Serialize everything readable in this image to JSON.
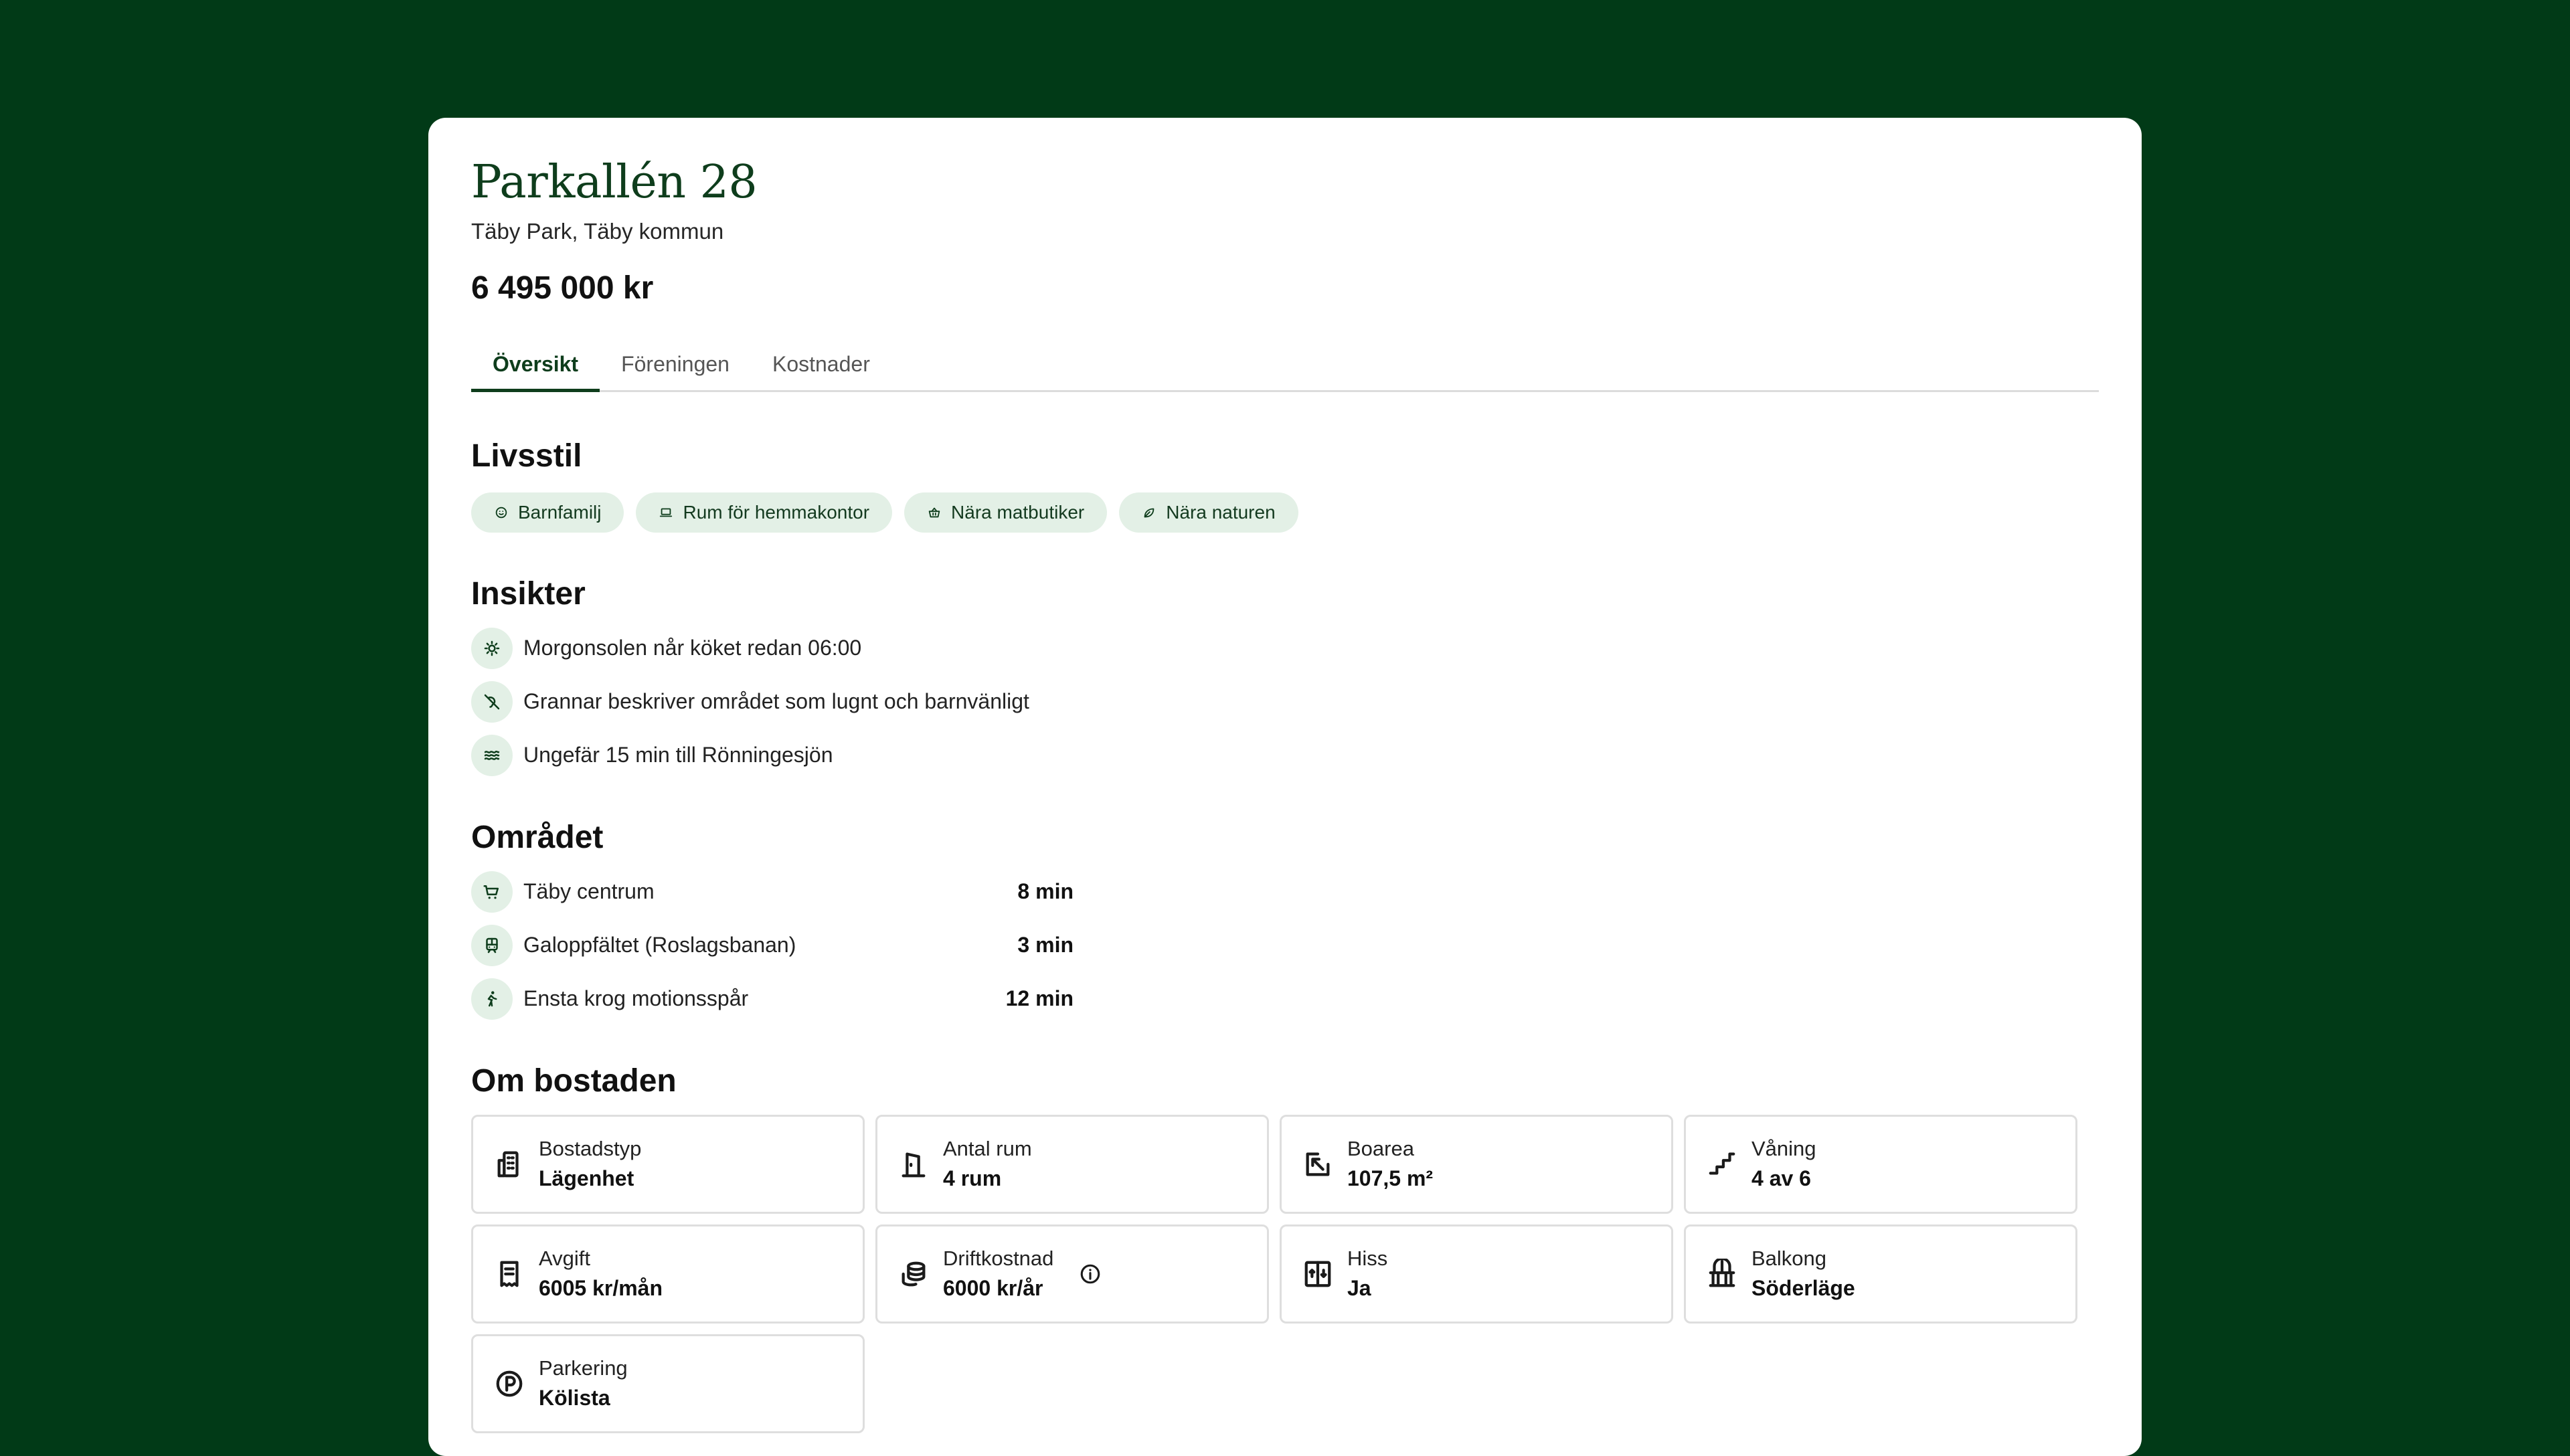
{
  "listing": {
    "title": "Parkallén 28",
    "subtitle": "Täby Park, Täby kommun",
    "price": "6 495 000 kr"
  },
  "tabs": [
    {
      "label": "Översikt",
      "active": true
    },
    {
      "label": "Föreningen",
      "active": false
    },
    {
      "label": "Kostnader",
      "active": false
    }
  ],
  "livsstil": {
    "title": "Livsstil",
    "chips": [
      {
        "label": "Barnfamilj",
        "icon": "smile-icon"
      },
      {
        "label": "Rum för hemmakontor",
        "icon": "laptop-icon"
      },
      {
        "label": "Nära matbutiker",
        "icon": "basket-icon"
      },
      {
        "label": "Nära naturen",
        "icon": "leaf-icon"
      }
    ]
  },
  "insikter": {
    "title": "Insikter",
    "items": [
      {
        "text": "Morgonsolen når köket redan 06:00",
        "icon": "sun-icon"
      },
      {
        "text": "Grannar beskriver området som lugnt och barnvänligt",
        "icon": "volume-off-icon"
      },
      {
        "text": "Ungefär 15 min till Rönningesjön",
        "icon": "waves-icon"
      }
    ]
  },
  "omradet": {
    "title": "Området",
    "items": [
      {
        "place": "Täby centrum",
        "time": "8 min",
        "icon": "cart-icon"
      },
      {
        "place": "Galoppfältet (Roslagsbanan)",
        "time": "3 min",
        "icon": "train-icon"
      },
      {
        "place": "Ensta krog motionsspår",
        "time": "12 min",
        "icon": "walk-icon"
      }
    ]
  },
  "om_bostaden": {
    "title": "Om bostaden",
    "features": [
      {
        "label": "Bostadstyp",
        "value": "Lägenhet",
        "icon": "building-icon"
      },
      {
        "label": "Antal rum",
        "value": "4 rum",
        "icon": "door-icon"
      },
      {
        "label": "Boarea",
        "value": "107,5 m²",
        "icon": "resize-icon"
      },
      {
        "label": "Våning",
        "value": "4 av 6",
        "icon": "stairs-icon"
      },
      {
        "label": "Avgift",
        "value": "6005 kr/mån",
        "icon": "receipt-icon"
      },
      {
        "label": "Driftkostnad",
        "value": "6000 kr/år",
        "icon": "coins-icon",
        "info": true
      },
      {
        "label": "Hiss",
        "value": "Ja",
        "icon": "elevator-icon"
      },
      {
        "label": "Balkong",
        "value": "Söderläge",
        "icon": "balcony-icon"
      },
      {
        "label": "Parkering",
        "value": "Kölista",
        "icon": "parking-icon"
      }
    ]
  },
  "colors": {
    "background": "#013a17",
    "accent": "#0e3d1c",
    "chip_bg": "#e3f0e6"
  }
}
